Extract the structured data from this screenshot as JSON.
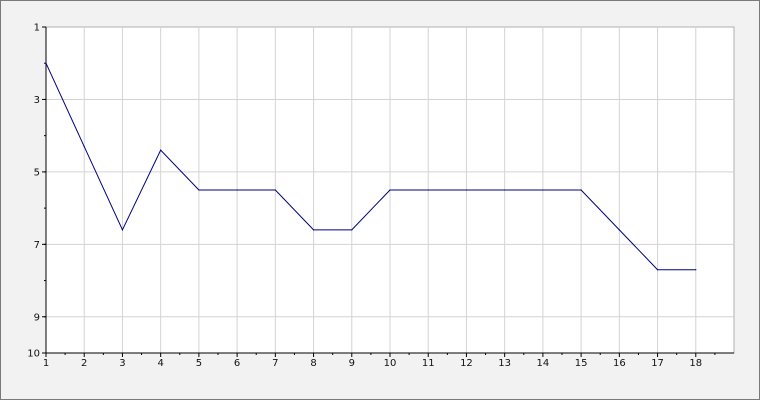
{
  "chart_data": {
    "type": "line",
    "x": [
      1,
      2,
      3,
      4,
      5,
      6,
      7,
      8,
      9,
      10,
      11,
      12,
      13,
      14,
      15,
      16,
      17,
      18
    ],
    "series": [
      {
        "values": [
          2,
          4.3,
          6.6,
          4.4,
          5.5,
          5.5,
          5.5,
          6.6,
          6.6,
          5.5,
          5.5,
          5.5,
          5.5,
          5.5,
          5.5,
          6.6,
          7.7,
          7.7
        ]
      }
    ],
    "xlim": [
      1,
      19
    ],
    "ylim": [
      1,
      10
    ],
    "y_inverted": true,
    "x_ticks": [
      "1",
      "2",
      "3",
      "4",
      "5",
      "6",
      "7",
      "8",
      "9",
      "10",
      "11",
      "12",
      "13",
      "14",
      "15",
      "16",
      "17",
      "18"
    ],
    "y_ticks": [
      "1",
      "3",
      "5",
      "7",
      "9",
      "10"
    ],
    "grid": true,
    "colors": {
      "line": "#000080",
      "grid": "#d3d3d3",
      "plot_bg": "#ffffff",
      "page_bg": "#f2f2f2"
    }
  }
}
